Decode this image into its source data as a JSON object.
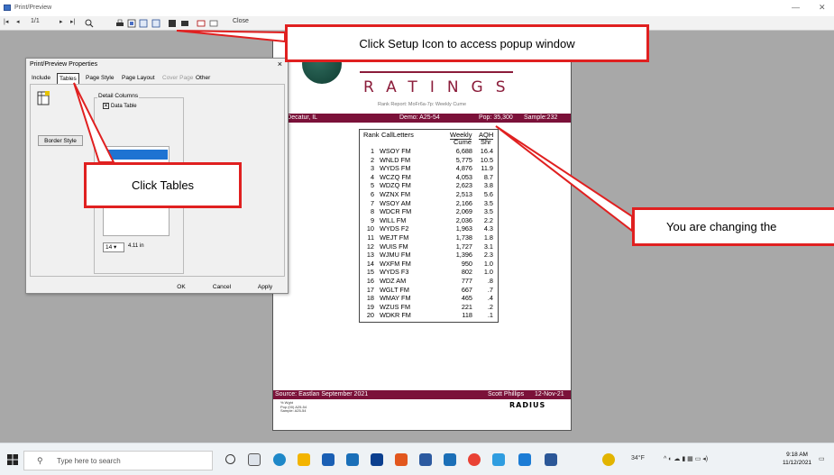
{
  "window": {
    "title": "Print/Preview",
    "minimize": "—",
    "close": "✕"
  },
  "toolbar": {
    "page_indicator": "1/1",
    "close_label": "Close",
    "first_page": "|◂",
    "prev_page": "◂",
    "next_page": "▸",
    "last_page": "▸|",
    "zoom_icon": "magnifier-icon",
    "print_icon": "printer-icon",
    "setup_icon": "setup-icon"
  },
  "callouts": {
    "setup": "Click Setup Icon to access popup window",
    "tables": "Click Tables",
    "changing": "You are changing the"
  },
  "dialog": {
    "title": "Print/Preview Properties",
    "tabs": [
      "Include",
      "Tables",
      "Page Style",
      "Page Layout",
      "Cover Page",
      "Other"
    ],
    "active_tab": "Tables",
    "disabled_tab": "Cover Page",
    "legend": "Detail Columns",
    "checkbox_label": "Data Table",
    "checkbox_checked": true,
    "border_button": "Border Style",
    "spin_value": "14",
    "spin_measure": "4.11 in",
    "ok": "OK",
    "cancel": "Cancel",
    "apply": "Apply"
  },
  "report": {
    "brand": "RATINGS",
    "subtitle": "Rank Report: MoFr6a-7p: Weekly Cume",
    "market": "ket: Decatur, IL",
    "demo": "Demo: A25-54",
    "pop": "Pop: 35,300",
    "sample": "Sample:232",
    "headers": {
      "rank": "Rank",
      "call": "CallLetters",
      "cume_1": "Weekly",
      "cume_2": "Cume",
      "aqh_1": "AQH",
      "aqh_2": "Shr"
    },
    "rows": [
      {
        "rank": "1",
        "call": "WSOY FM",
        "cume": "6,688",
        "aqh": "16.4"
      },
      {
        "rank": "2",
        "call": "WNLD FM",
        "cume": "5,775",
        "aqh": "10.5"
      },
      {
        "rank": "3",
        "call": "WYDS FM",
        "cume": "4,876",
        "aqh": "11.9"
      },
      {
        "rank": "4",
        "call": "WCZQ FM",
        "cume": "4,053",
        "aqh": "8.7"
      },
      {
        "rank": "5",
        "call": "WDZQ FM",
        "cume": "2,623",
        "aqh": "3.8"
      },
      {
        "rank": "6",
        "call": "WZNX FM",
        "cume": "2,513",
        "aqh": "5.6"
      },
      {
        "rank": "7",
        "call": "WSOY AM",
        "cume": "2,166",
        "aqh": "3.5"
      },
      {
        "rank": "8",
        "call": "WDCR FM",
        "cume": "2,069",
        "aqh": "3.5"
      },
      {
        "rank": "9",
        "call": "WILL FM",
        "cume": "2,036",
        "aqh": "2.2"
      },
      {
        "rank": "10",
        "call": "WYDS F2",
        "cume": "1,963",
        "aqh": "4.3"
      },
      {
        "rank": "11",
        "call": "WEJT FM",
        "cume": "1,738",
        "aqh": "1.8"
      },
      {
        "rank": "12",
        "call": "WUIS FM",
        "cume": "1,727",
        "aqh": "3.1"
      },
      {
        "rank": "13",
        "call": "WJMU FM",
        "cume": "1,396",
        "aqh": "2.3"
      },
      {
        "rank": "14",
        "call": "WXFM FM",
        "cume": "950",
        "aqh": "1.0"
      },
      {
        "rank": "15",
        "call": "WYDS F3",
        "cume": "802",
        "aqh": "1.0"
      },
      {
        "rank": "16",
        "call": "WDZ AM",
        "cume": "777",
        "aqh": ".8"
      },
      {
        "rank": "17",
        "call": "WGLT FM",
        "cume": "667",
        "aqh": ".7"
      },
      {
        "rank": "18",
        "call": "WMAY FM",
        "cume": "465",
        "aqh": ".4"
      },
      {
        "rank": "19",
        "call": "WZUS FM",
        "cume": "221",
        "aqh": ".2"
      },
      {
        "rank": "20",
        "call": "WDKR FM",
        "cume": "118",
        "aqh": ".1"
      }
    ],
    "source": "Source: Eastlan September 2021",
    "author": "Scott Phillips",
    "date": "12-Nov-21",
    "radius_logo": "RADIUS",
    "footer_lines": [
      "% Wght",
      "Pop (00)  A25-54",
      "Sample:   A25-54"
    ]
  },
  "taskbar": {
    "search_placeholder": "Type here to search",
    "weather": "34°F",
    "time": "9:18 AM",
    "date": "11/12/2021"
  }
}
